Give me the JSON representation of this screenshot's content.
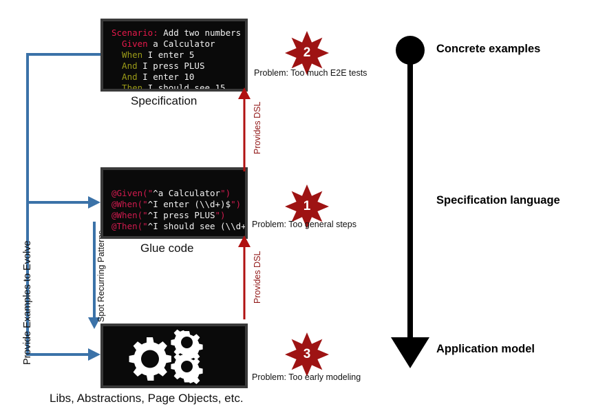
{
  "diagram": {
    "title_present": false,
    "colors": {
      "star_fill": "#9e1313",
      "red_arrow": "#b01010",
      "blue_arrow": "#3b72a8",
      "panel_bg": "#0a0a0a",
      "panel_border": "#3a3a3a",
      "keyword_pink": "#e6194b",
      "keyword_olive": "#9a9a18",
      "code_text": "#f2f2f2",
      "black": "#000000"
    }
  },
  "specification_panel": {
    "caption": "Specification",
    "lines": [
      [
        {
          "text": "Scenario:",
          "style": "kw-pink"
        },
        {
          "text": " Add two numbers",
          "style": "plain"
        }
      ],
      [
        {
          "text": "  Given",
          "style": "kw-pink"
        },
        {
          "text": " a Calculator",
          "style": "plain"
        }
      ],
      [
        {
          "text": "  When",
          "style": "kw-olive"
        },
        {
          "text": " I enter 5",
          "style": "plain"
        }
      ],
      [
        {
          "text": "  And",
          "style": "kw-olive"
        },
        {
          "text": " I press PLUS",
          "style": "plain"
        }
      ],
      [
        {
          "text": "  And",
          "style": "kw-olive"
        },
        {
          "text": " I enter 10",
          "style": "plain"
        }
      ],
      [
        {
          "text": "  Then",
          "style": "kw-olive"
        },
        {
          "text": " I should see 15",
          "style": "plain"
        }
      ]
    ]
  },
  "glue_code_panel": {
    "caption": "Glue code",
    "lines": [
      [
        {
          "text": "@Given(\"",
          "style": "crimson"
        },
        {
          "text": "^a Calculator",
          "style": "plain"
        },
        {
          "text": "\")",
          "style": "crimson"
        }
      ],
      [
        {
          "text": "@When(\"",
          "style": "crimson"
        },
        {
          "text": "^I enter (\\\\d+)$",
          "style": "plain"
        },
        {
          "text": "\")",
          "style": "crimson"
        }
      ],
      [
        {
          "text": "@When(\"",
          "style": "crimson"
        },
        {
          "text": "^I press PLUS",
          "style": "plain"
        },
        {
          "text": "\")",
          "style": "crimson"
        }
      ],
      [
        {
          "text": "@Then(\"",
          "style": "crimson"
        },
        {
          "text": "^I should see (\\\\d+)$",
          "style": "plain"
        },
        {
          "text": "\")",
          "style": "crimson"
        }
      ]
    ]
  },
  "abstractions_panel": {
    "caption": "Libs, Abstractions, Page Objects, etc.",
    "icon": "gears-icon"
  },
  "problems": [
    {
      "number": "2",
      "label": "Problem: Too much E2E tests"
    },
    {
      "number": "1",
      "label": "Problem: Too general steps"
    },
    {
      "number": "3",
      "label": "Problem: Too early modeling"
    }
  ],
  "flow_labels": {
    "provide_examples": "Provide Examples to Evolve",
    "spot_patterns": "Spot Recurring Patterns",
    "provides_dsl_upper": "Provides DSL",
    "provides_dsl_lower": "Provides DSL"
  },
  "abstraction_axis": {
    "top_label": "Concrete examples",
    "middle_label": "Specification language",
    "bottom_label": "Application model"
  }
}
